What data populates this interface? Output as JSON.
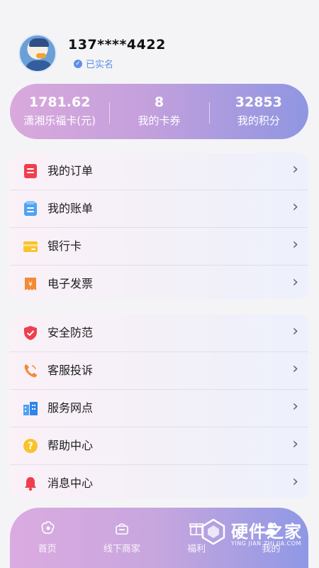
{
  "profile": {
    "phone": "137****4422",
    "verified": "已实名"
  },
  "stats": [
    {
      "value": "1781.62",
      "label": "潇湘乐福卡(元)"
    },
    {
      "value": "8",
      "label": "我的卡券"
    },
    {
      "value": "32853",
      "label": "我的积分"
    }
  ],
  "menu_group1": [
    {
      "label": "我的订单",
      "icon": "order-icon"
    },
    {
      "label": "我的账单",
      "icon": "bill-icon"
    },
    {
      "label": "银行卡",
      "icon": "bank-card-icon"
    },
    {
      "label": "电子发票",
      "icon": "invoice-icon"
    }
  ],
  "menu_group2": [
    {
      "label": "安全防范",
      "icon": "shield-icon"
    },
    {
      "label": "客服投诉",
      "icon": "phone-icon"
    },
    {
      "label": "服务网点",
      "icon": "building-icon"
    },
    {
      "label": "帮助中心",
      "icon": "help-icon"
    },
    {
      "label": "消息中心",
      "icon": "bell-icon"
    }
  ],
  "bottom_nav": [
    {
      "label": "首页",
      "icon": "home-icon"
    },
    {
      "label": "线下商家",
      "icon": "store-icon"
    },
    {
      "label": "福利",
      "icon": "gift-icon"
    },
    {
      "label": "我的",
      "icon": "profile-icon"
    }
  ],
  "watermark": {
    "title": "硬件之家",
    "subtitle": "YING JIAN ZHI JIA.COM"
  },
  "colors": {
    "accent_blue": "#5e8ee9",
    "red": "#ef3e4e",
    "orange": "#f28b35",
    "yellow": "#f8c42b",
    "blue": "#4ea2f3"
  }
}
